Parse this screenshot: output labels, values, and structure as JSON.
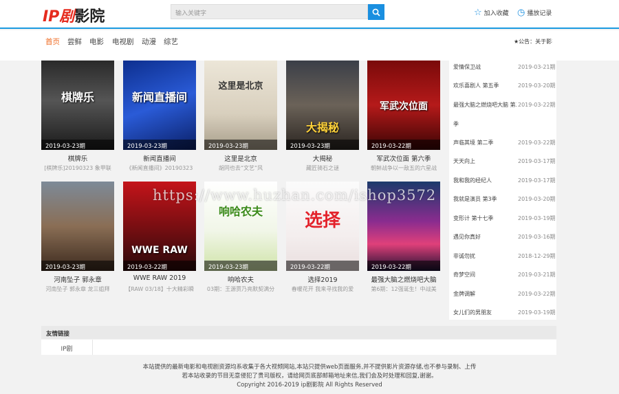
{
  "logo": {
    "ip": "IP剧",
    "rest": "影院"
  },
  "search": {
    "placeholder": "输入关键字"
  },
  "header_links": {
    "favorite": "加入收藏",
    "history": "播放记录"
  },
  "nav": [
    "首页",
    "尝鲜",
    "电影",
    "电视剧",
    "动漫",
    "综艺"
  ],
  "notice": "★公告：关于影视",
  "colors": {
    "accent": "#1a8fe0",
    "active_nav": "#ef6a21",
    "logo_red": "#e52b1e"
  },
  "cards_row1": [
    {
      "date": "2019-03-23期",
      "title": "棋牌乐",
      "desc": "[棋牌乐]20190323 象甲联",
      "poster_text": "棋牌乐"
    },
    {
      "date": "2019-03-23期",
      "title": "新闻直播间",
      "desc": "《新闻直播间》20190323",
      "poster_text": "新闻直播间"
    },
    {
      "date": "2019-03-23期",
      "title": "这里是北京",
      "desc": "胡同也去“文艺”风",
      "poster_text": "这里是北京"
    },
    {
      "date": "2019-03-23期",
      "title": "大揭秘",
      "desc": "藏匠骑石之谜",
      "poster_text": "大揭秘"
    },
    {
      "date": "2019-03-22期",
      "title": "军武次位面 第六季",
      "desc": "朝鲜战争以一敌五的六星战",
      "poster_text": "军武次位面"
    }
  ],
  "cards_row2": [
    {
      "date": "2019-03-23期",
      "title": "河南坠子 郭永章",
      "desc": "河南坠子 郭永章 龙三姐拜",
      "poster_text": ""
    },
    {
      "date": "2019-03-22期",
      "title": "WWE RAW 2019",
      "desc": "【RAW 03/18】十大精彩瞬",
      "poster_text": "WWE RAW"
    },
    {
      "date": "2019-03-23期",
      "title": "响哈农夫",
      "desc": "03期：王源贾乃亮默契满分",
      "poster_text": "响哈农夫"
    },
    {
      "date": "2019-03-22期",
      "title": "选择2019",
      "desc": "春暖花开 我来寻找我的爱",
      "poster_text": "选择"
    },
    {
      "date": "2019-03-22期",
      "title": "最强大脑之燃烧吧大脑",
      "desc": "第6期：12强诞生！中战美",
      "poster_text": ""
    }
  ],
  "right_list": [
    {
      "title": "爱情保卫战",
      "date": "2019-03-21期"
    },
    {
      "title": "欢乐喜剧人 第五季",
      "date": "2019-03-20期"
    },
    {
      "title": "最强大脑之燃烧吧大脑 第二季",
      "date": "2019-03-22期"
    },
    {
      "title": "季",
      "date": ""
    },
    {
      "title": "声临其境 第二季",
      "date": "2019-03-22期"
    },
    {
      "title": "天天向上",
      "date": "2019-03-17期"
    },
    {
      "title": "我和我的经纪人",
      "date": "2019-03-17期"
    },
    {
      "title": "我就是演员 第3季",
      "date": "2019-03-20期"
    },
    {
      "title": "变形计 第十七季",
      "date": "2019-03-19期"
    },
    {
      "title": "遇见你真好",
      "date": "2019-03-16期"
    },
    {
      "title": "非诚勿扰",
      "date": "2018-12-29期"
    },
    {
      "title": "奇梦空间",
      "date": "2019-03-21期"
    },
    {
      "title": "金牌调解",
      "date": "2019-03-22期"
    },
    {
      "title": "女儿们的男朋友",
      "date": "2019-03-19期"
    }
  ],
  "friend_links": {
    "heading": "友情链接",
    "items": [
      "IP剧"
    ]
  },
  "footer": {
    "line1": "本站提供的最新电影和电视剧资源均系收集于各大视频网站,本站只提供web页面服务,并不提供影片资源存储,也不参与录制、上传",
    "line2": "若本站收录的节目无意侵犯了贵司版权，请给网页底部邮箱地址来信,我们会及时处理和回复,谢谢。",
    "line3": "Copyright 2016-2019 ip剧影院 All Rights Reserved"
  },
  "watermark": "https://www.huzhan.com/ishop3572"
}
